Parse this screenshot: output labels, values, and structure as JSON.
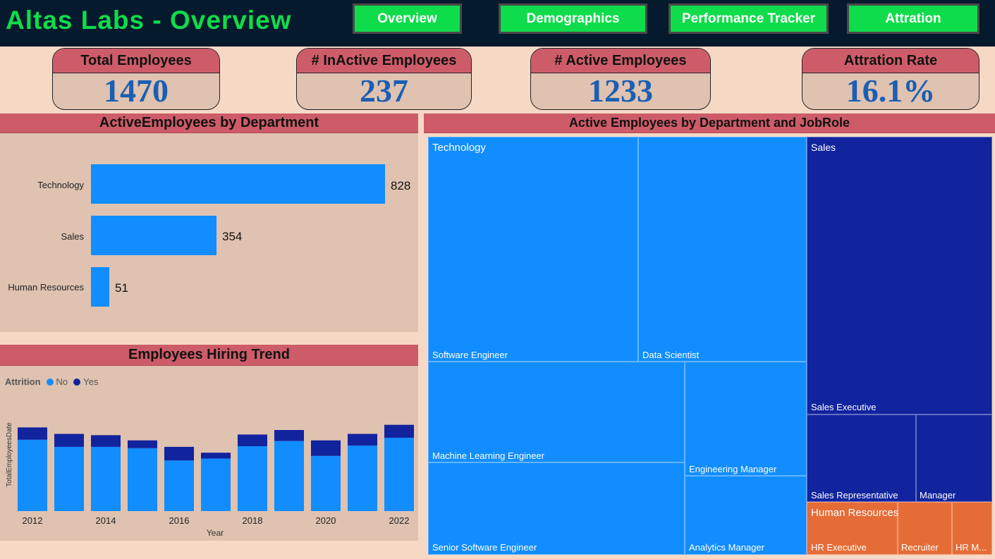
{
  "header": {
    "title": "Altas Labs - Overview",
    "nav": [
      "Overview",
      "Demographics",
      "Performance Tracker",
      "Attration"
    ]
  },
  "kpis": [
    {
      "label": "Total Employees",
      "value": "1470"
    },
    {
      "label": "# InActive Employees",
      "value": "237"
    },
    {
      "label": "# Active Employees",
      "value": "1233"
    },
    {
      "label": "Attration Rate",
      "value": "16.1%"
    }
  ],
  "dept_chart": {
    "title": "ActiveEmployees by Department",
    "categories": [
      "Technology",
      "Sales",
      "Human Resources"
    ],
    "value_labels": [
      "828",
      "354",
      "51"
    ]
  },
  "trend_chart": {
    "title": "Employees Hiring Trend",
    "legend_title": "Attrition",
    "legend_items": [
      "No",
      "Yes"
    ],
    "ylabel": "TotalEmployeesDate",
    "xlabel": "Year",
    "x_tick_labels": [
      "2012",
      "2014",
      "2016",
      "2018",
      "2020",
      "2022"
    ]
  },
  "treemap": {
    "title": "Active Employees by Department and JobRole",
    "groups": [
      "Technology",
      "Sales",
      "Human Resources"
    ],
    "roles": [
      "Software Engineer",
      "Data Scientist",
      "Machine Learning Engineer",
      "Engineering Manager",
      "Senior Software Engineer",
      "Analytics Manager",
      "Sales Executive",
      "Sales Representative",
      "Manager",
      "HR Executive",
      "Recruiter",
      "HR M..."
    ]
  },
  "colors": {
    "header_bg": "#061a2e",
    "accent_green": "#0fdc4a",
    "panel_head": "#cd5c68",
    "panel_bg": "#dfc2b0",
    "page_bg": "#f6d9c5",
    "no_blue": "#118dff",
    "yes_navy": "#12239e",
    "hr_orange": "#e66c37",
    "kpi_value": "#1a5fb4"
  },
  "chart_data": [
    {
      "type": "bar",
      "title": "ActiveEmployees by Department",
      "categories": [
        "Technology",
        "Sales",
        "Human Resources"
      ],
      "values": [
        828,
        354,
        51
      ]
    },
    {
      "type": "bar",
      "title": "Employees Hiring Trend",
      "xlabel": "Year",
      "ylabel": "TotalEmployeesDate",
      "stacked": true,
      "categories": [
        "2012",
        "2013",
        "2014",
        "2015",
        "2016",
        "2017",
        "2018",
        "2019",
        "2020",
        "2021",
        "2022"
      ],
      "series": [
        {
          "name": "No",
          "values": [
            110,
            99,
            99,
            97,
            78,
            81,
            100,
            108,
            85,
            101,
            113
          ]
        },
        {
          "name": "Yes",
          "values": [
            19,
            20,
            18,
            12,
            21,
            9,
            18,
            17,
            24,
            18,
            20
          ]
        }
      ],
      "legend": "top-left"
    },
    {
      "type": "treemap",
      "title": "Active Employees by Department and JobRole",
      "groups": [
        "Technology",
        "Sales",
        "Human Resources"
      ],
      "roles": [
        "Software Engineer",
        "Data Scientist",
        "Machine Learning Engineer",
        "Engineering Manager",
        "Senior Software Engineer",
        "Analytics Manager",
        "Sales Executive",
        "Sales Representative",
        "Manager",
        "HR Executive",
        "Recruiter",
        "HR M..."
      ]
    }
  ]
}
